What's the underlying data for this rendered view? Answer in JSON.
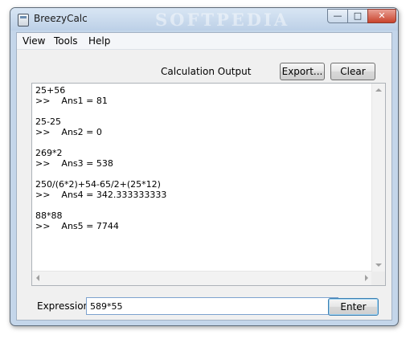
{
  "window": {
    "title": "BreezyCalc",
    "watermark": "SOFTPEDIA"
  },
  "menu": {
    "items": [
      "View",
      "Tools",
      "Help"
    ]
  },
  "toolbar": {
    "output_label": "Calculation Output",
    "export_label": "Export...",
    "clear_label": "Clear"
  },
  "output": {
    "entries": [
      {
        "expression": "25+56",
        "result": ">>    Ans1 = 81"
      },
      {
        "expression": "25-25",
        "result": ">>    Ans2 = 0"
      },
      {
        "expression": "269*2",
        "result": ">>    Ans3 = 538"
      },
      {
        "expression": "250/(6*2)+54-65/2+(25*12)",
        "result": ">>    Ans4 = 342.333333333"
      },
      {
        "expression": "88*88",
        "result": ">>    Ans5 = 7744"
      }
    ]
  },
  "expression": {
    "label": "Expression:",
    "value": "589*55"
  },
  "enter_label": "Enter",
  "colors": {
    "title_gradient": "#bcd0e7",
    "close_button": "#c9432c",
    "default_button_border": "#3c7fb1",
    "input_border": "#7da2ce"
  }
}
